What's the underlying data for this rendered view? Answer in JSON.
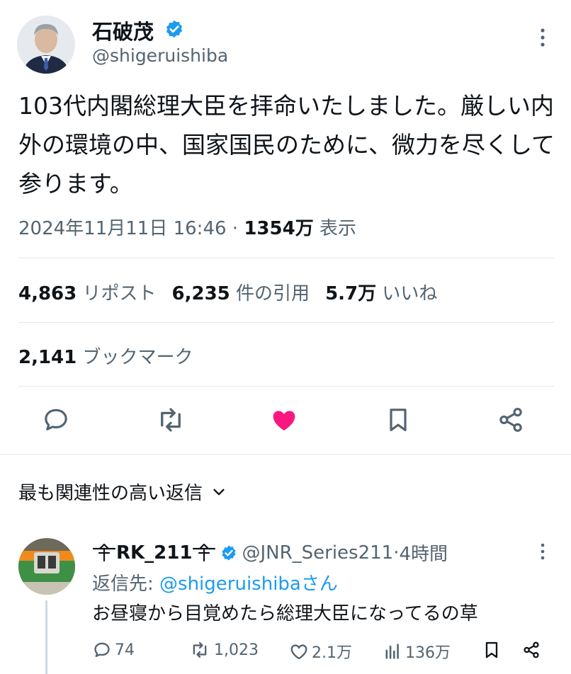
{
  "tweet": {
    "author_name": "石破茂",
    "author_handle": "@shigeruishiba",
    "text": "103代内閣総理大臣を拝命いたしました。厳しい内外の環境の中、国家国民のために、微力を尽くして参ります。",
    "timestamp": "2024年11月11日 16:46",
    "separator": " · ",
    "views_count": "1354万",
    "views_label": "表示"
  },
  "stats": {
    "reposts_count": "4,863",
    "reposts_label": "リポスト",
    "quotes_count": "6,235",
    "quotes_label": "件の引用",
    "likes_count": "5.7万",
    "likes_label": "いいね",
    "bookmarks_count": "2,141",
    "bookmarks_label": "ブックマーク"
  },
  "actions": {
    "reply_icon": "reply-icon",
    "repost_icon": "repost-icon",
    "like_icon": "heart-filled-icon",
    "bookmark_icon": "bookmark-icon",
    "share_icon": "share-icon",
    "like_color": "#f91880"
  },
  "replies_section": {
    "title": "最も関連性の高い返信"
  },
  "reply": {
    "name": "RK_211",
    "handle": "@JNR_Series211",
    "time": "4時間",
    "separator": " · ",
    "reply_to_label": "返信先: ",
    "reply_to_mention": "@shigeruishibaさん",
    "text": "お昼寝から目覚めたら総理大臣になってるの草",
    "reply_count": "74",
    "repost_count": "1,023",
    "like_count": "2.1万",
    "view_count": "136万"
  },
  "colors": {
    "text_primary": "#0f1419",
    "text_secondary": "#536471",
    "accent": "#1d9bf0",
    "verified": "#1d9bf0"
  }
}
